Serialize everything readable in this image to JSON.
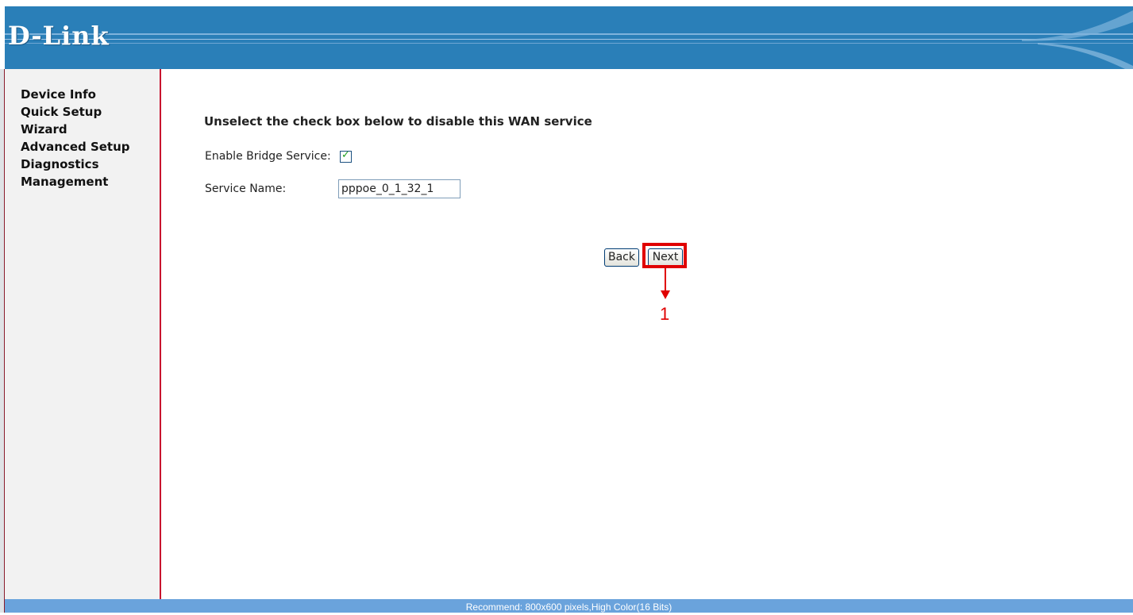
{
  "header": {
    "logo_text": "D-Link"
  },
  "sidebar": {
    "items": [
      {
        "label": "Device Info"
      },
      {
        "label": "Quick Setup"
      },
      {
        "label": "Wizard"
      },
      {
        "label": "Advanced Setup"
      },
      {
        "label": "Diagnostics"
      },
      {
        "label": "Management"
      }
    ]
  },
  "main": {
    "instruction": "Unselect the check box below to disable this WAN service",
    "enable_bridge_label": "Enable Bridge Service:",
    "enable_bridge_checked": true,
    "service_name_label": "Service Name:",
    "service_name_value": "pppoe_0_1_32_1",
    "back_label": "Back",
    "next_label": "Next",
    "annotation_number": "1"
  },
  "footer": {
    "text": "Recommend: 800x600 pixels,High Color(16 Bits)"
  },
  "colors": {
    "header": "#2a7fb8",
    "sidebar": "#f2f2f2",
    "sidebar_border": "#c8102e",
    "footer": "#6aa3dc",
    "annotation": "#e00000"
  }
}
